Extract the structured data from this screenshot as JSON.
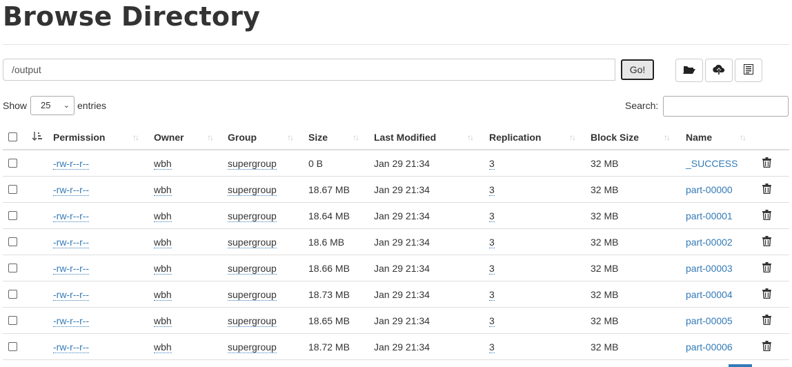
{
  "page": {
    "title": "Browse Directory"
  },
  "path_bar": {
    "value": "/output",
    "go_label": "Go!"
  },
  "toolbar": {
    "icons": [
      "folder-open-icon",
      "cloud-upload-icon",
      "list-icon"
    ]
  },
  "table_controls": {
    "show_label": "Show",
    "page_size": "25",
    "entries_label": "entries",
    "search_label": "Search:",
    "search_value": ""
  },
  "columns": [
    "Permission",
    "Owner",
    "Group",
    "Size",
    "Last Modified",
    "Replication",
    "Block Size",
    "Name"
  ],
  "rows": [
    {
      "permission": "-rw-r--r--",
      "owner": "wbh",
      "group": "supergroup",
      "size": "0 B",
      "modified": "Jan 29 21:34",
      "replication": "3",
      "block_size": "32 MB",
      "name": "_SUCCESS"
    },
    {
      "permission": "-rw-r--r--",
      "owner": "wbh",
      "group": "supergroup",
      "size": "18.67 MB",
      "modified": "Jan 29 21:34",
      "replication": "3",
      "block_size": "32 MB",
      "name": "part-00000"
    },
    {
      "permission": "-rw-r--r--",
      "owner": "wbh",
      "group": "supergroup",
      "size": "18.64 MB",
      "modified": "Jan 29 21:34",
      "replication": "3",
      "block_size": "32 MB",
      "name": "part-00001"
    },
    {
      "permission": "-rw-r--r--",
      "owner": "wbh",
      "group": "supergroup",
      "size": "18.6 MB",
      "modified": "Jan 29 21:34",
      "replication": "3",
      "block_size": "32 MB",
      "name": "part-00002"
    },
    {
      "permission": "-rw-r--r--",
      "owner": "wbh",
      "group": "supergroup",
      "size": "18.66 MB",
      "modified": "Jan 29 21:34",
      "replication": "3",
      "block_size": "32 MB",
      "name": "part-00003"
    },
    {
      "permission": "-rw-r--r--",
      "owner": "wbh",
      "group": "supergroup",
      "size": "18.73 MB",
      "modified": "Jan 29 21:34",
      "replication": "3",
      "block_size": "32 MB",
      "name": "part-00004"
    },
    {
      "permission": "-rw-r--r--",
      "owner": "wbh",
      "group": "supergroup",
      "size": "18.65 MB",
      "modified": "Jan 29 21:34",
      "replication": "3",
      "block_size": "32 MB",
      "name": "part-00005"
    },
    {
      "permission": "-rw-r--r--",
      "owner": "wbh",
      "group": "supergroup",
      "size": "18.72 MB",
      "modified": "Jan 29 21:34",
      "replication": "3",
      "block_size": "32 MB",
      "name": "part-00006"
    }
  ],
  "colors": {
    "link": "#337ab7",
    "border": "#dddddd",
    "text": "#333333"
  }
}
